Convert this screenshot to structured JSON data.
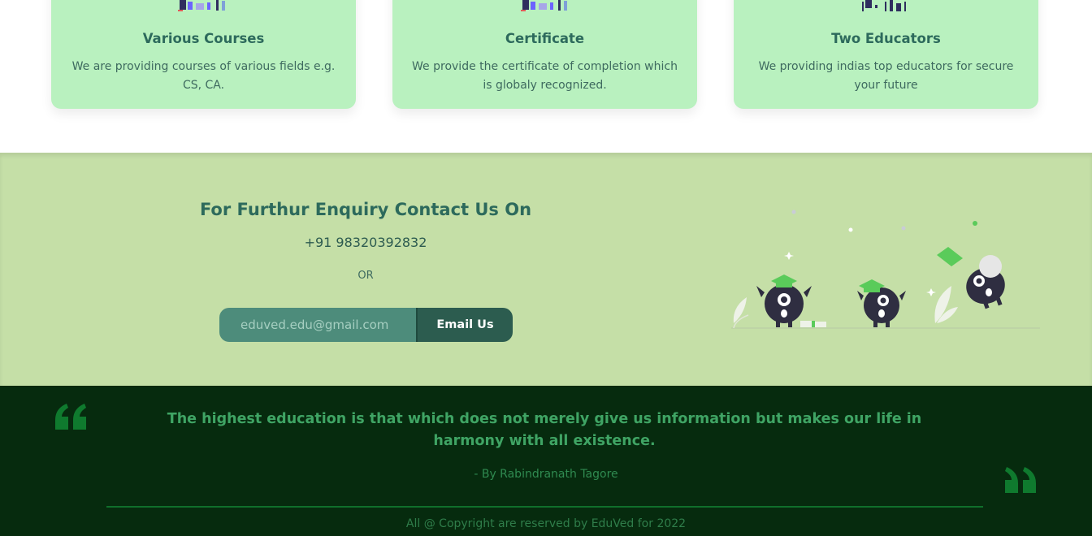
{
  "features": {
    "cards": [
      {
        "title": "Various Courses",
        "text": "We are providing courses of various fields e.g. CS, CA."
      },
      {
        "title": "Certificate",
        "text": "We provide the certificate of completion which is globaly recognized."
      },
      {
        "title": "Two Educators",
        "text": "We providing indias top educators for secure your future"
      }
    ]
  },
  "contact": {
    "heading": "For Furthur Enquiry Contact Us On",
    "phone": "+91 98320392832",
    "or": "OR",
    "email_value": "eduved.edu@gmail.com",
    "email_button": "Email Us",
    "illustration_icon": "graduation-monsters-illustration"
  },
  "quote": {
    "text": "The highest education is that which does not merely give us information but makes our life in harmony with all existence.",
    "author": "- By Rabindranath Tagore",
    "copyright": "All @ Copyright are reserved by EduVed for 2022"
  },
  "colors": {
    "card_bg": "#b9f1bf",
    "contact_bg": "#c5dfa7",
    "footer_bg": "#062b0e",
    "accent_dark": "#2c5c4f",
    "quote_green": "#3fa464"
  }
}
